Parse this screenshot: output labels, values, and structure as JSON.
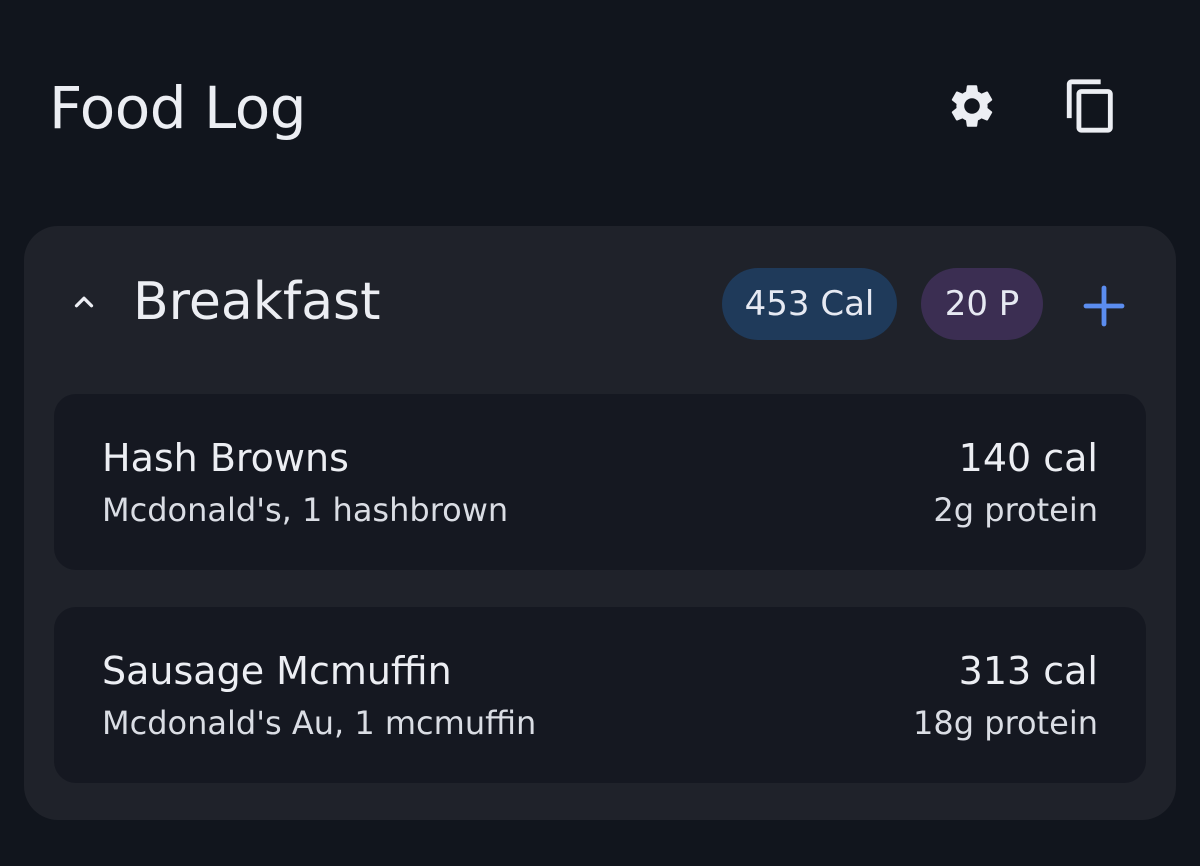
{
  "header": {
    "title": "Food Log",
    "settings_icon": "gear-icon",
    "copy_icon": "copy-icon"
  },
  "meal": {
    "name": "Breakfast",
    "collapse_icon": "chevron-up-icon",
    "calories_badge": "453 Cal",
    "protein_badge": "20 P",
    "add_icon": "plus-icon",
    "items": [
      {
        "name": "Hash Browns",
        "description": "Mcdonald's, 1 hashbrown",
        "calories": "140 cal",
        "protein": "2g protein"
      },
      {
        "name": "Sausage Mcmuffin",
        "description": "Mcdonald's Au, 1 mcmuffin",
        "calories": "313 cal",
        "protein": "18g protein"
      }
    ]
  },
  "colors": {
    "background": "#11151d",
    "card": "#1f222a",
    "item": "#151821",
    "calories_badge": "#1f3a5a",
    "protein_badge": "#3b2e52",
    "accent": "#5b8def"
  }
}
